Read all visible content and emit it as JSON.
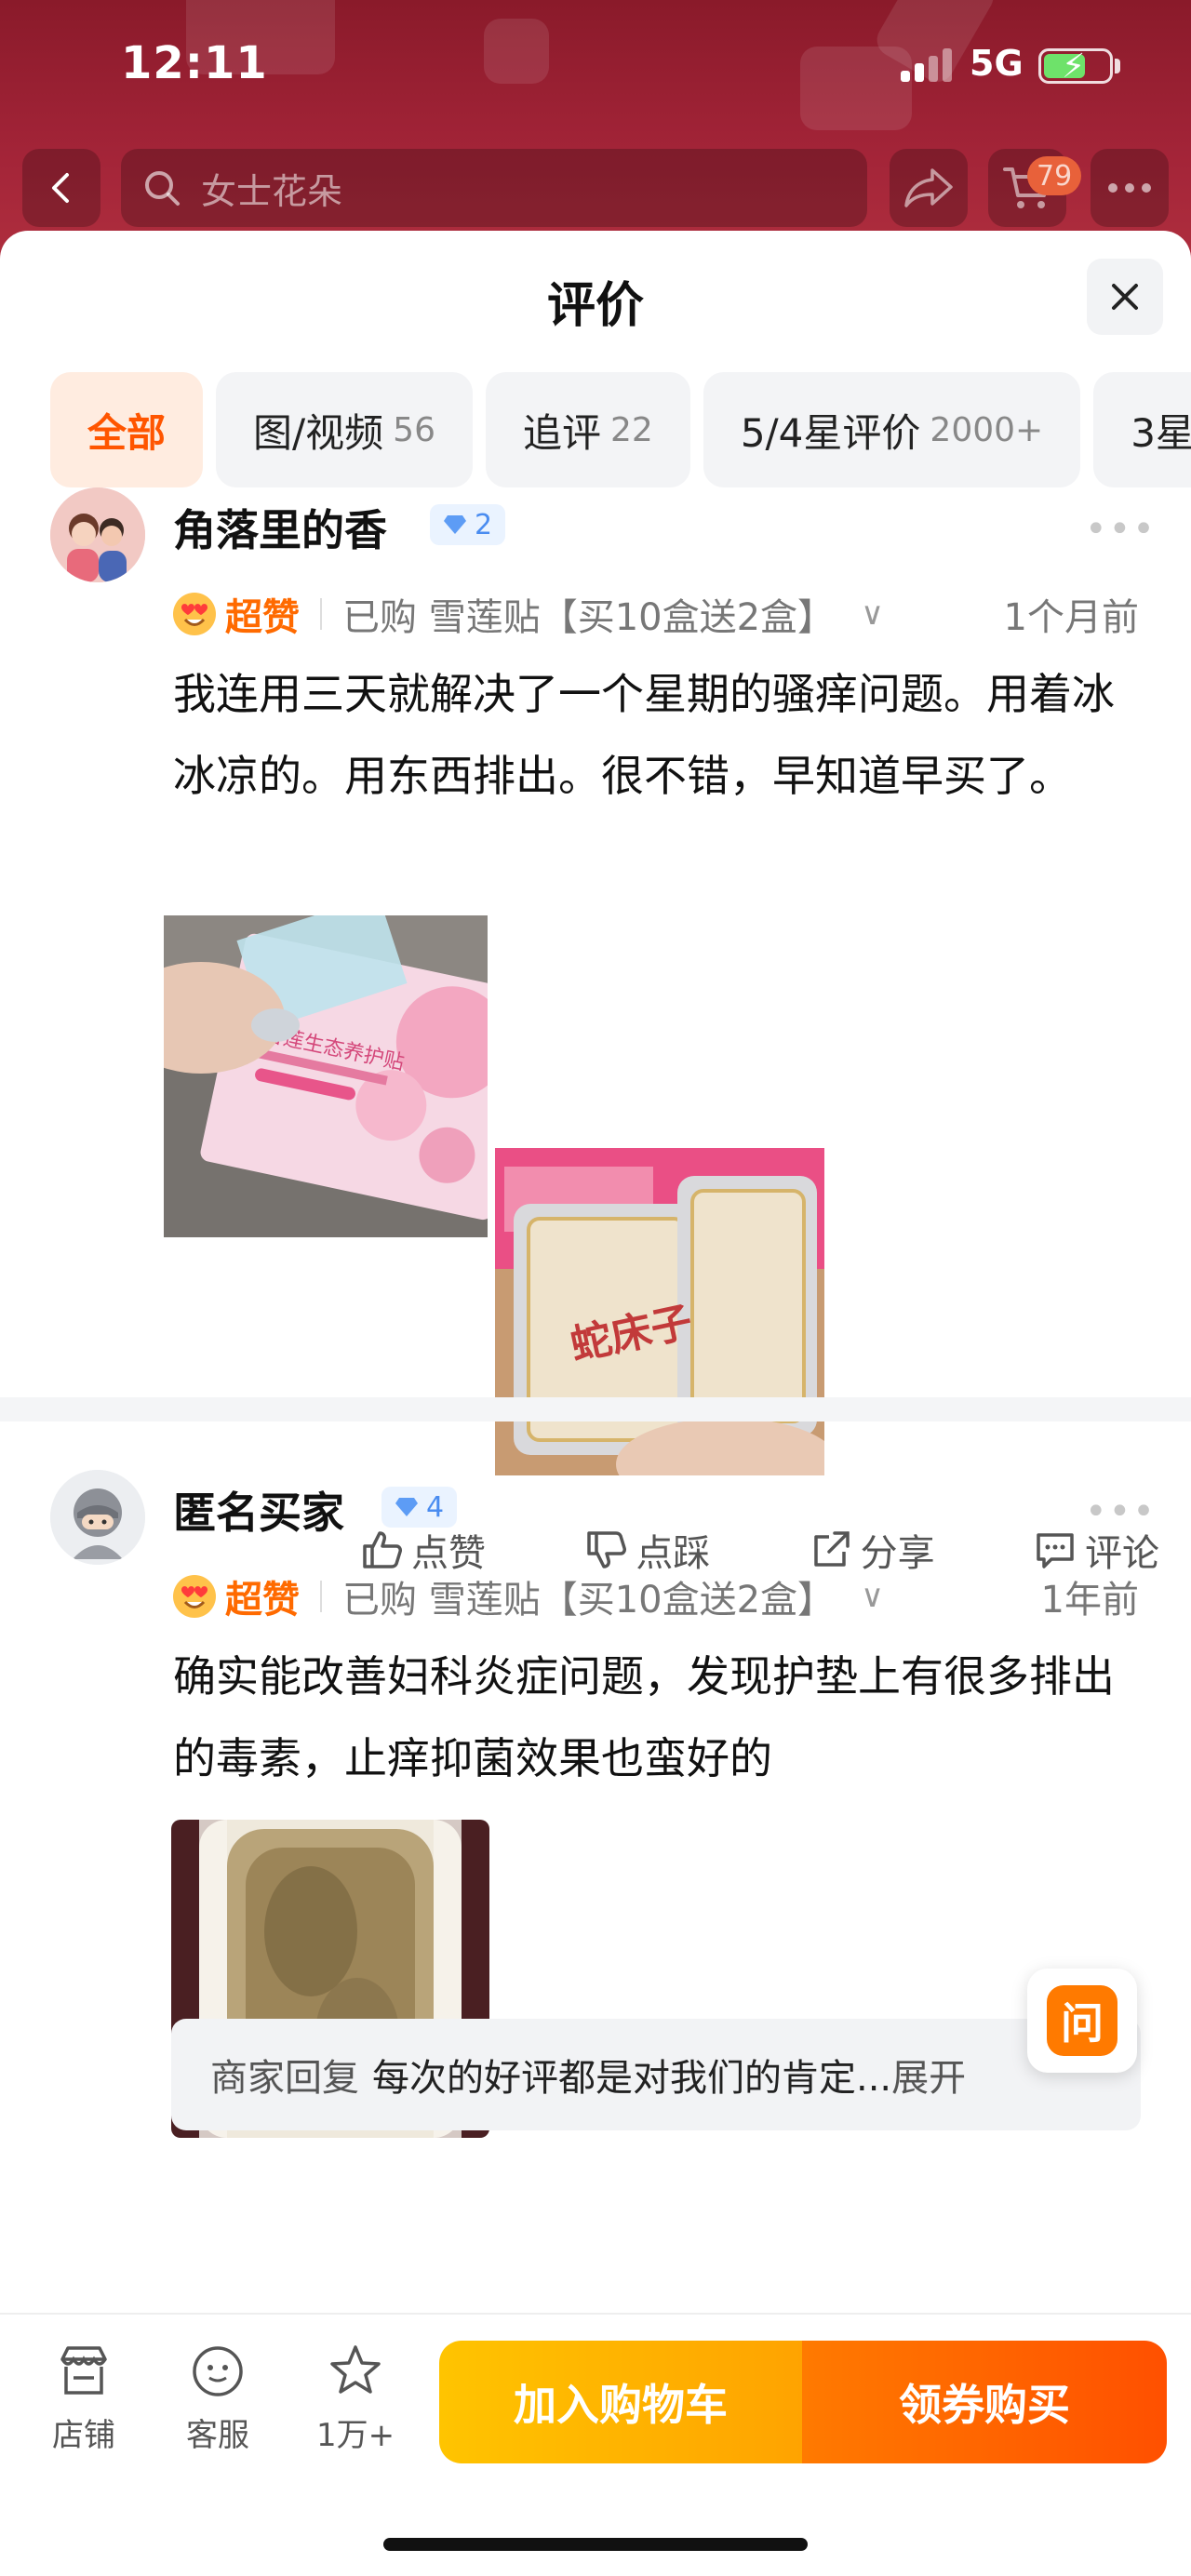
{
  "status_bar": {
    "time": "12:11",
    "network": "5G"
  },
  "nav": {
    "search_placeholder": "女士花朵",
    "cart_badge": "79",
    "icons": [
      "back-icon",
      "search-icon",
      "share-icon",
      "cart-icon",
      "more-icon"
    ]
  },
  "sheet": {
    "title": "评价",
    "tabs": [
      {
        "label": "全部",
        "count": ""
      },
      {
        "label": "图/视频",
        "count": "56"
      },
      {
        "label": "追评",
        "count": "22"
      },
      {
        "label": "5/4星评价",
        "count": "2000+"
      },
      {
        "label": "3星",
        "count": ""
      }
    ]
  },
  "reviews": [
    {
      "user": "角落里的香",
      "level": "2",
      "badge": "超赞",
      "purchase": "已购 雪莲贴【买10盒送2盒】",
      "time": "1个月前",
      "text": "我连用三天就解决了一个星期的骚痒问题。用着冰冰凉的。用东西排出。很不错，早知道早买了。",
      "photos": [
        {
          "caption": "雪莲生态养护贴"
        },
        {
          "caption": "蛇床子"
        }
      ],
      "actions": [
        "点赞",
        "点踩",
        "分享",
        "评论"
      ]
    },
    {
      "user": "匿名买家",
      "level": "4",
      "badge": "超赞",
      "purchase": "已购 雪莲贴【买10盒送2盒】",
      "time": "1年前",
      "text": "确实能改善妇科炎症问题，发现护垫上有很多排出的毒素，止痒抑菌效果也蛮好的",
      "reply": {
        "label": "商家回复",
        "text": "每次的好评都是对我们的肯定...",
        "expand": "展开"
      }
    }
  ],
  "float_button": {
    "label": "问"
  },
  "bottom_bar": {
    "shop": "店铺",
    "service": "客服",
    "favorite": "1万+",
    "add_to_cart": "加入购物车",
    "buy": "领券购买"
  },
  "colors": {
    "accent": "#ff5500",
    "cart_button": "#ffb300",
    "buy_button": "#ff6000",
    "header_bg": "#a32438"
  }
}
